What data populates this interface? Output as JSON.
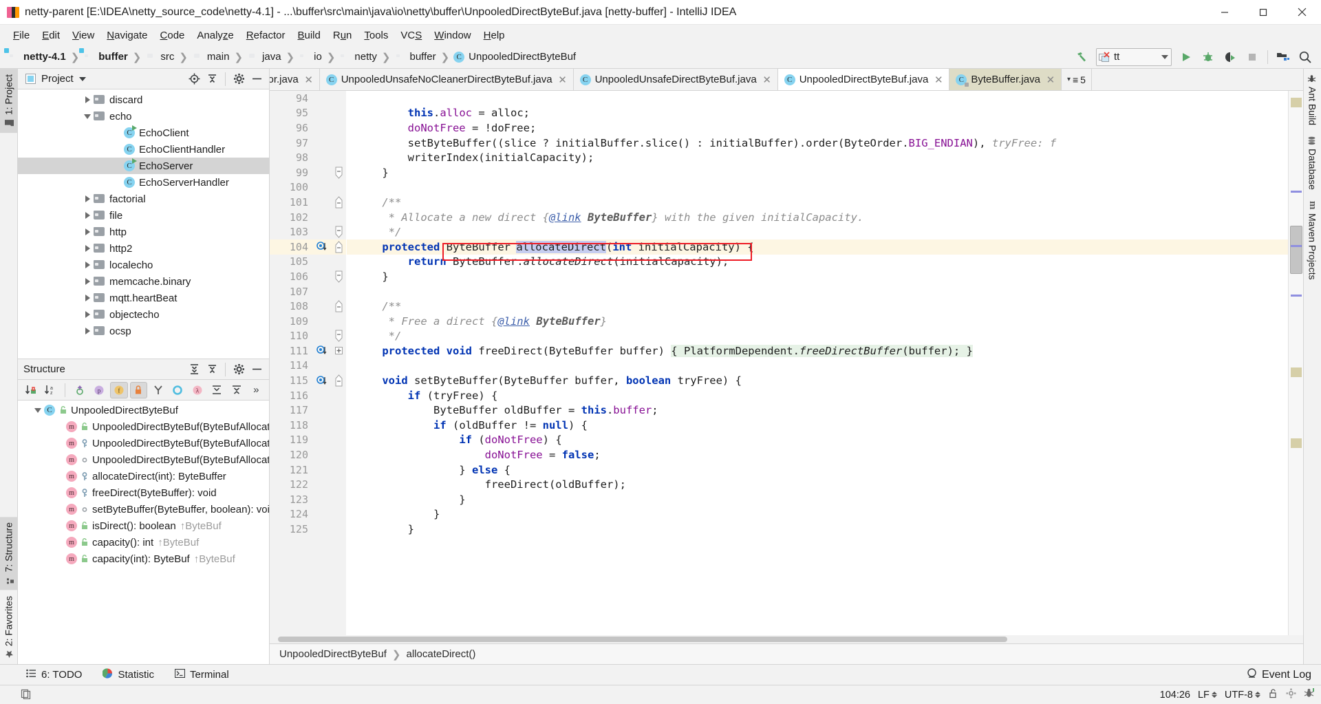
{
  "window": {
    "title": "netty-parent [E:\\IDEA\\netty_source_code\\netty-4.1] - ...\\buffer\\src\\main\\java\\io\\netty\\buffer\\UnpooledDirectByteBuf.java [netty-buffer] - IntelliJ IDEA",
    "minimize_label": "Minimize",
    "maximize_label": "Maximize",
    "close_label": "Close"
  },
  "menubar": {
    "items": [
      {
        "label": "File"
      },
      {
        "label": "Edit"
      },
      {
        "label": "View"
      },
      {
        "label": "Navigate"
      },
      {
        "label": "Code"
      },
      {
        "label": "Analyze"
      },
      {
        "label": "Refactor"
      },
      {
        "label": "Build"
      },
      {
        "label": "Run"
      },
      {
        "label": "Tools"
      },
      {
        "label": "VCS"
      },
      {
        "label": "Window"
      },
      {
        "label": "Help"
      }
    ]
  },
  "breadcrumbs": {
    "items": [
      {
        "label": "netty-4.1",
        "icon": "module-folder-icon",
        "bold": true
      },
      {
        "label": "buffer",
        "icon": "module-folder-icon",
        "bold": true
      },
      {
        "label": "src",
        "icon": "folder-icon",
        "bold": false
      },
      {
        "label": "main",
        "icon": "folder-icon",
        "bold": false
      },
      {
        "label": "java",
        "icon": "source-folder-icon",
        "bold": false
      },
      {
        "label": "io",
        "icon": "package-icon",
        "bold": false
      },
      {
        "label": "netty",
        "icon": "package-icon",
        "bold": false
      },
      {
        "label": "buffer",
        "icon": "package-icon",
        "bold": false
      },
      {
        "label": "UnpooledDirectByteBuf",
        "icon": "class-icon",
        "bold": false
      }
    ]
  },
  "toolbar": {
    "build_label": "Build Project",
    "run_config": "tt",
    "run_label": "Run",
    "debug_label": "Debug",
    "run_coverage_label": "Run with Coverage",
    "stop_label": "Stop",
    "project_structure_label": "Project Structure",
    "search_label": "Search Everywhere"
  },
  "left_strip": {
    "items": [
      {
        "label": "1: Project",
        "icon": "project-icon",
        "active": true
      },
      {
        "label": "7: Structure",
        "icon": "structure-icon",
        "active": true
      },
      {
        "label": "2: Favorites",
        "icon": "star-icon",
        "active": false
      }
    ]
  },
  "right_strip": {
    "items": [
      {
        "label": "Ant Build",
        "icon": "ant-icon"
      },
      {
        "label": "Database",
        "icon": "database-icon"
      },
      {
        "label": "Maven Projects",
        "icon": "maven-icon"
      }
    ]
  },
  "project_panel": {
    "title": "Project",
    "dropdown_label": "Project view dropdown",
    "locate_label": "Select Opened File",
    "collapse_label": "Collapse All",
    "settings_label": "Settings",
    "hide_label": "Hide",
    "tree": [
      {
        "label": "discard",
        "indent": 4,
        "arrow": "right",
        "icon": "package-icon",
        "selected": false
      },
      {
        "label": "echo",
        "indent": 4,
        "arrow": "down",
        "icon": "package-icon",
        "selected": false
      },
      {
        "label": "EchoClient",
        "indent": 6,
        "arrow": "none",
        "icon": "runnable-class-icon",
        "selected": false
      },
      {
        "label": "EchoClientHandler",
        "indent": 6,
        "arrow": "none",
        "icon": "class-icon",
        "selected": false
      },
      {
        "label": "EchoServer",
        "indent": 6,
        "arrow": "none",
        "icon": "runnable-class-icon",
        "selected": true
      },
      {
        "label": "EchoServerHandler",
        "indent": 6,
        "arrow": "none",
        "icon": "class-icon",
        "selected": false
      },
      {
        "label": "factorial",
        "indent": 4,
        "arrow": "right",
        "icon": "package-icon",
        "selected": false
      },
      {
        "label": "file",
        "indent": 4,
        "arrow": "right",
        "icon": "package-icon",
        "selected": false
      },
      {
        "label": "http",
        "indent": 4,
        "arrow": "right",
        "icon": "package-icon",
        "selected": false
      },
      {
        "label": "http2",
        "indent": 4,
        "arrow": "right",
        "icon": "package-icon",
        "selected": false
      },
      {
        "label": "localecho",
        "indent": 4,
        "arrow": "right",
        "icon": "package-icon",
        "selected": false
      },
      {
        "label": "memcache.binary",
        "indent": 4,
        "arrow": "right",
        "icon": "package-icon",
        "selected": false
      },
      {
        "label": "mqtt.heartBeat",
        "indent": 4,
        "arrow": "right",
        "icon": "package-icon",
        "selected": false
      },
      {
        "label": "objectecho",
        "indent": 4,
        "arrow": "right",
        "icon": "package-icon",
        "selected": false
      },
      {
        "label": "ocsp",
        "indent": 4,
        "arrow": "right",
        "icon": "package-icon",
        "selected": false
      }
    ]
  },
  "structure_panel": {
    "title": "Structure",
    "expand_label": "Expand All",
    "collapse_label": "Collapse All",
    "settings_label": "Settings",
    "hide_label": "Hide",
    "filters": [
      {
        "name": "sort-by-visibility-button",
        "label": "Sort by Visibility",
        "on": false
      },
      {
        "name": "sort-alphabetically-button",
        "label": "Sort Alphabetically",
        "on": false
      },
      {
        "name": "show-inherited-button",
        "label": "Show Inherited",
        "on": false
      },
      {
        "name": "show-properties-button",
        "label": "Show Properties",
        "on": false
      },
      {
        "name": "show-fields-button",
        "label": "Show Fields",
        "on": true
      },
      {
        "name": "show-non-public-button",
        "label": "Show Non-Public",
        "on": true
      },
      {
        "name": "show-anonymous-button",
        "label": "Show Anonymous Classes",
        "on": false
      },
      {
        "name": "show-interfaces-button",
        "label": "Show Interfaces",
        "on": false
      },
      {
        "name": "show-lambdas-button",
        "label": "Show Lambdas",
        "on": false
      },
      {
        "name": "expand-all-button",
        "label": "Expand All",
        "on": false
      },
      {
        "name": "collapse-all-button",
        "label": "Collapse All",
        "on": false
      },
      {
        "name": "more-button",
        "label": "More",
        "on": false
      }
    ],
    "tree": [
      {
        "label": "UnpooledDirectByteBuf",
        "indent": 1,
        "arrow": "down",
        "kind": "class",
        "vis": "public",
        "override": ""
      },
      {
        "label": "UnpooledDirectByteBuf(ByteBufAllocator,",
        "indent": 3,
        "arrow": "none",
        "kind": "method",
        "vis": "public",
        "override": ""
      },
      {
        "label": "UnpooledDirectByteBuf(ByteBufAllocator,",
        "indent": 3,
        "arrow": "none",
        "kind": "method",
        "vis": "protected",
        "override": ""
      },
      {
        "label": "UnpooledDirectByteBuf(ByteBufAllocator,",
        "indent": 3,
        "arrow": "none",
        "kind": "method",
        "vis": "package",
        "override": ""
      },
      {
        "label": "allocateDirect(int): ByteBuffer",
        "indent": 3,
        "arrow": "none",
        "kind": "method",
        "vis": "protected",
        "override": ""
      },
      {
        "label": "freeDirect(ByteBuffer): void",
        "indent": 3,
        "arrow": "none",
        "kind": "method",
        "vis": "protected",
        "override": ""
      },
      {
        "label": "setByteBuffer(ByteBuffer, boolean): void",
        "indent": 3,
        "arrow": "none",
        "kind": "method",
        "vis": "package",
        "override": ""
      },
      {
        "label": "isDirect(): boolean",
        "indent": 3,
        "arrow": "none",
        "kind": "method",
        "vis": "public",
        "override": "↑ByteBuf"
      },
      {
        "label": "capacity(): int",
        "indent": 3,
        "arrow": "none",
        "kind": "method",
        "vis": "public",
        "override": "↑ByteBuf"
      },
      {
        "label": "capacity(int): ByteBuf",
        "indent": 3,
        "arrow": "none",
        "kind": "method",
        "vis": "public",
        "override": "↑ByteBuf"
      }
    ]
  },
  "editor_tabs": {
    "tabs": [
      {
        "label": "ator.java",
        "icon": "class-icon",
        "state": "clipped",
        "closable": true
      },
      {
        "label": "UnpooledUnsafeNoCleanerDirectByteBuf.java",
        "icon": "class-icon",
        "state": "normal",
        "closable": true
      },
      {
        "label": "UnpooledUnsafeDirectByteBuf.java",
        "icon": "class-icon",
        "state": "normal",
        "closable": true
      },
      {
        "label": "UnpooledDirectByteBuf.java",
        "icon": "class-icon",
        "state": "active",
        "closable": true
      },
      {
        "label": "ByteBuffer.java",
        "icon": "class-locked-icon",
        "state": "focused",
        "closable": true
      }
    ],
    "tab_count": "5"
  },
  "editor": {
    "lines": [
      {
        "num": "94",
        "html": "",
        "current": false,
        "gutter_icon": "",
        "fold": ""
      },
      {
        "num": "95",
        "html": "        <span class='kw'>this</span>.<span class='fld2'>alloc</span> = alloc;",
        "current": false,
        "gutter_icon": "",
        "fold": ""
      },
      {
        "num": "96",
        "html": "        <span class='fld2'>doNotFree</span> = !doFree;",
        "current": false,
        "gutter_icon": "",
        "fold": ""
      },
      {
        "num": "97",
        "html": "        setByteBuffer((slice ? initialBuffer.slice() : initialBuffer).order(ByteOrder.<span class='fld2'>BIG_ENDIAN</span>), <span class='cmt'>tryFree:</span> <span class='cmt'>f</span>",
        "current": false,
        "gutter_icon": "",
        "fold": ""
      },
      {
        "num": "98",
        "html": "        writerIndex(initialCapacity);",
        "current": false,
        "gutter_icon": "",
        "fold": ""
      },
      {
        "num": "99",
        "html": "    }",
        "current": false,
        "gutter_icon": "",
        "fold": "end"
      },
      {
        "num": "100",
        "html": "",
        "current": false,
        "gutter_icon": "",
        "fold": ""
      },
      {
        "num": "101",
        "html": "    <span class='cmt'>/**</span>",
        "current": false,
        "gutter_icon": "",
        "fold": "start"
      },
      {
        "num": "102",
        "html": "     <span class='cmt'>* Allocate a new direct {<span class='lnk'>@link</span> <b>ByteBuffer</b>} with the given initialCapacity.</span>",
        "current": false,
        "gutter_icon": "",
        "fold": ""
      },
      {
        "num": "103",
        "html": "     <span class='cmt'>*/</span>",
        "current": false,
        "gutter_icon": "",
        "fold": "end"
      },
      {
        "num": "104",
        "html": "    <span class='kw'>protected</span> ByteBuffer <span class='caret'></span><span class='sel'>allocateDirect</span>(<span class='kw'>int</span> initialCapacity) {",
        "current": true,
        "gutter_icon": "override",
        "fold": "start"
      },
      {
        "num": "105",
        "html": "        <span class='kw'>return</span> ByteBuffer.<span class='stat'>allocateDirect</span>(initialCapacity);",
        "current": false,
        "gutter_icon": "",
        "fold": ""
      },
      {
        "num": "106",
        "html": "    }",
        "current": false,
        "gutter_icon": "",
        "fold": "end"
      },
      {
        "num": "107",
        "html": "",
        "current": false,
        "gutter_icon": "",
        "fold": ""
      },
      {
        "num": "108",
        "html": "    <span class='cmt'>/**</span>",
        "current": false,
        "gutter_icon": "",
        "fold": "start"
      },
      {
        "num": "109",
        "html": "     <span class='cmt'>* Free a direct {<span class='lnk'>@link</span> <b>ByteBuffer</b>}</span>",
        "current": false,
        "gutter_icon": "",
        "fold": ""
      },
      {
        "num": "110",
        "html": "     <span class='cmt'>*/</span>",
        "current": false,
        "gutter_icon": "",
        "fold": "end"
      },
      {
        "num": "111",
        "html": "    <span class='kw'>protected</span> <span class='kw'>void</span> freeDirect(ByteBuffer buffer) <span class='folded'>{ PlatformDependent.<span class='stat'>freeDirectBuffer</span>(buffer); }</span>",
        "current": false,
        "gutter_icon": "override",
        "fold": "collapsed"
      },
      {
        "num": "114",
        "html": "",
        "current": false,
        "gutter_icon": "",
        "fold": ""
      },
      {
        "num": "115",
        "html": "    <span class='kw'>void</span> setByteBuffer(ByteBuffer buffer, <span class='kw'>boolean</span> tryFree) {",
        "current": false,
        "gutter_icon": "override",
        "fold": "start"
      },
      {
        "num": "116",
        "html": "        <span class='kw'>if</span> (tryFree) {",
        "current": false,
        "gutter_icon": "",
        "fold": ""
      },
      {
        "num": "117",
        "html": "            ByteBuffer oldBuffer = <span class='kw'>this</span>.<span class='fld2'>buffer</span>;",
        "current": false,
        "gutter_icon": "",
        "fold": ""
      },
      {
        "num": "118",
        "html": "            <span class='kw'>if</span> (oldBuffer != <span class='kw'>null</span>) {",
        "current": false,
        "gutter_icon": "",
        "fold": ""
      },
      {
        "num": "119",
        "html": "                <span class='kw'>if</span> (<span class='fld2'>doNotFree</span>) {",
        "current": false,
        "gutter_icon": "",
        "fold": ""
      },
      {
        "num": "120",
        "html": "                    <span class='fld2'>doNotFree</span> = <span class='kw'>false</span>;",
        "current": false,
        "gutter_icon": "",
        "fold": ""
      },
      {
        "num": "121",
        "html": "                } <span class='kw'>else</span> {",
        "current": false,
        "gutter_icon": "",
        "fold": ""
      },
      {
        "num": "122",
        "html": "                    freeDirect(oldBuffer);",
        "current": false,
        "gutter_icon": "",
        "fold": ""
      },
      {
        "num": "123",
        "html": "                }",
        "current": false,
        "gutter_icon": "",
        "fold": ""
      },
      {
        "num": "124",
        "html": "            }",
        "current": false,
        "gutter_icon": "",
        "fold": ""
      },
      {
        "num": "125",
        "html": "        }",
        "current": false,
        "gutter_icon": "",
        "fold": ""
      }
    ],
    "annotation_label": "red-highlight-box"
  },
  "editor_breadcrumb": {
    "items": [
      {
        "label": "UnpooledDirectByteBuf"
      },
      {
        "label": "allocateDirect()"
      }
    ]
  },
  "tool_window_bar": {
    "items": [
      {
        "label": "6: TODO",
        "icon": "todo-icon"
      },
      {
        "label": "Statistic",
        "icon": "statistic-icon"
      },
      {
        "label": "Terminal",
        "icon": "terminal-icon"
      }
    ],
    "event_log": "Event Log"
  },
  "statusbar": {
    "caret_position": "104:26",
    "line_separator": "LF",
    "encoding": "UTF-8",
    "lock_label": "Read-only toggle",
    "inspection_label": "Inspections",
    "memory_label": "Memory"
  },
  "colors": {
    "accent_blue": "#0033b3",
    "field_purple": "#871094",
    "comment_gray": "#8c8c8c",
    "annotation_red": "#ee1c25",
    "current_line": "#fdf6e3",
    "selection": "#c6cdf0",
    "run_green": "#59a869",
    "class_icon_blue": "#86d3f0",
    "method_icon_pink": "#f5a9bd"
  }
}
